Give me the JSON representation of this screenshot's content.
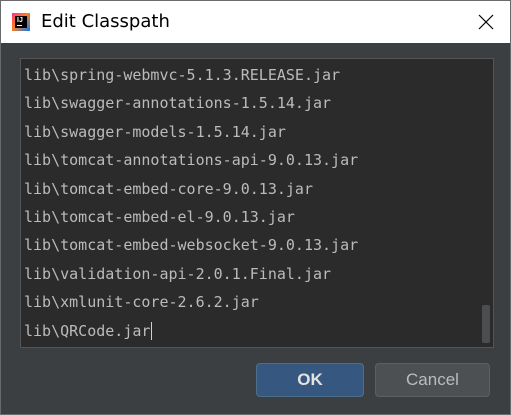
{
  "window": {
    "title": "Edit Classpath",
    "app_icon": "intellij-icon",
    "app_icon_glyph": "IJ",
    "close_icon": "close-icon"
  },
  "classpath": {
    "entries": [
      "lib\\spring-webmvc-5.1.3.RELEASE.jar",
      "lib\\swagger-annotations-1.5.14.jar",
      "lib\\swagger-models-1.5.14.jar",
      "lib\\tomcat-annotations-api-9.0.13.jar",
      "lib\\tomcat-embed-core-9.0.13.jar",
      "lib\\tomcat-embed-el-9.0.13.jar",
      "lib\\tomcat-embed-websocket-9.0.13.jar",
      "lib\\validation-api-2.0.1.Final.jar",
      "lib\\xmlunit-core-2.6.2.jar",
      "lib\\QRCode.jar"
    ]
  },
  "buttons": {
    "ok_label": "OK",
    "cancel_label": "Cancel"
  },
  "colors": {
    "panel_background": "#2b2b2b",
    "dialog_background": "#3c3f41",
    "text": "#bbbbbb",
    "ok_button": "#365880"
  }
}
